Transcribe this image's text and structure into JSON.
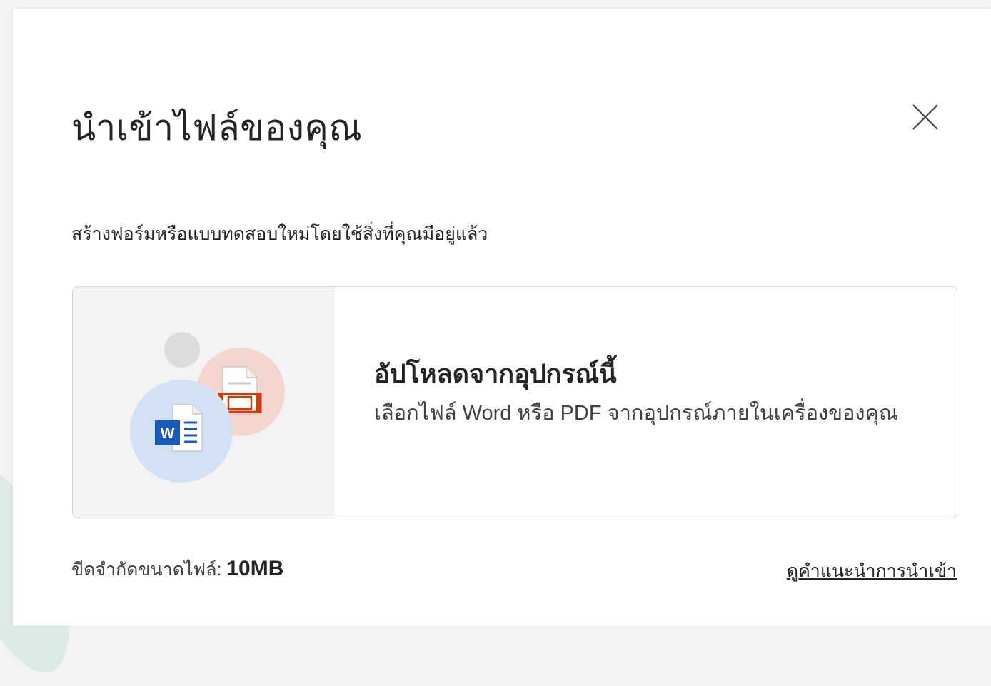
{
  "dialog": {
    "title": "นำเข้าไฟล์ของคุณ",
    "subtitle": "สร้างฟอร์มหรือแบบทดสอบใหม่โดยใช้สิ่งที่คุณมีอยู่แล้ว",
    "close_icon": "close-icon"
  },
  "upload_option": {
    "title": "อัปโหลดจากอุปกรณ์นี้",
    "description": "เลือกไฟล์ Word หรือ PDF จากอุปกรณ์ภายในเครื่องของคุณ",
    "icons": [
      "word-document-icon",
      "pdf-document-icon"
    ]
  },
  "footer": {
    "size_limit_label": "ขีดจำกัดขนาดไฟล์: ",
    "size_limit_value": "10MB",
    "guide_link": "ดูคำแนะนำการนำเข้า"
  },
  "colors": {
    "word_blue": "#185abd",
    "pdf_red": "#d83b01",
    "word_circle": "#d3e1f5",
    "pdf_circle": "#f5d6cf"
  }
}
